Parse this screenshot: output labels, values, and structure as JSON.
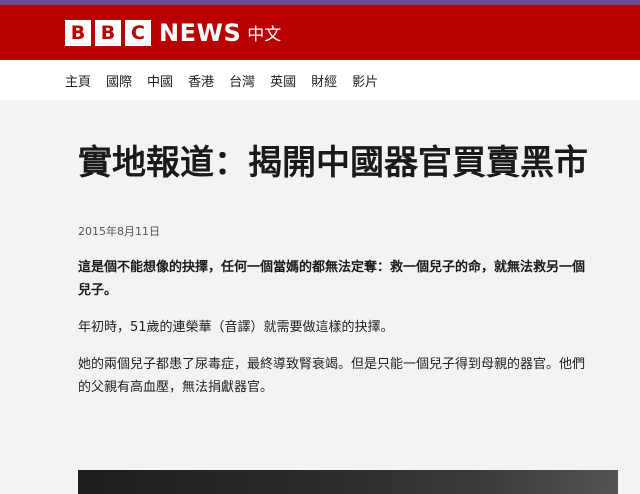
{
  "brand": {
    "blocks": [
      "B",
      "B",
      "C"
    ],
    "news": "NEWS",
    "chinese": "中文",
    "colors": {
      "masthead": "#b80000",
      "stripe": "#6b4a93"
    }
  },
  "nav": {
    "items": [
      "主頁",
      "國際",
      "中國",
      "香港",
      "台灣",
      "英國",
      "財經",
      "影片"
    ]
  },
  "article": {
    "headline": "實地報道：揭開中國器官買賣黑市",
    "date": "2015年8月11日",
    "lead": "這是個不能想像的抉擇，任何一個當媽的都無法定奪：救一個兒子的命，就無法救另一個兒子。",
    "paragraphs": [
      "年初時，51歲的連榮華（音譯）就需要做這樣的抉擇。",
      "她的兩個兒子都患了尿毒症，最終導致腎衰竭。但是只能一個兒子得到母親的器官。他們的父親有高血壓，無法捐獻器官。"
    ]
  }
}
